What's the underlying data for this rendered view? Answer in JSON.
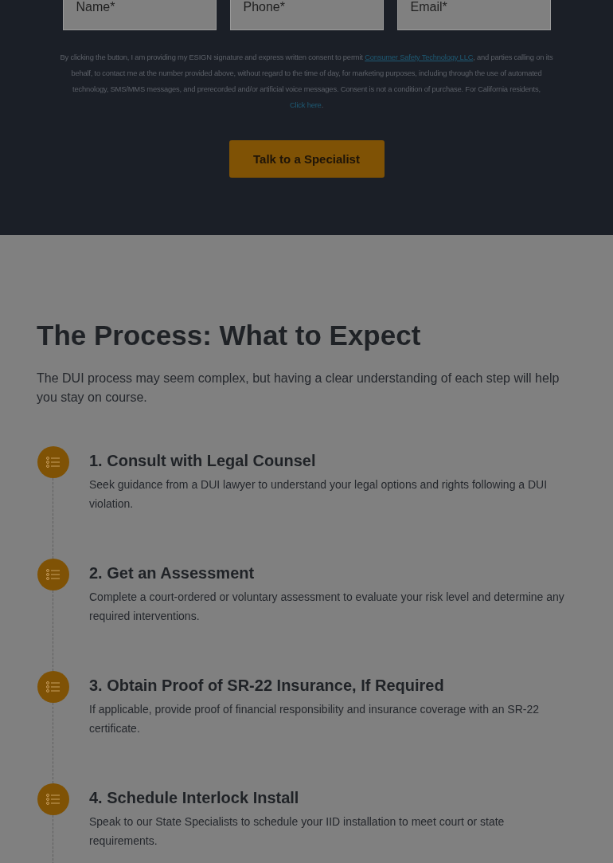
{
  "form": {
    "fields": [
      {
        "placeholder": "Name*"
      },
      {
        "placeholder": "Phone*"
      },
      {
        "placeholder": "Email*"
      }
    ],
    "consent": {
      "before": "By clicking the button, I am providing my ESIGN signature and express written consent to permit ",
      "link": "Consumer Safety Technology LLC",
      "middle": ", and parties calling on its behalf, to contact me at the number provided above, without regard to the time of day, for marketing purposes, including through the use of automated technology, SMS/MMS messages, and prerecorded and/or artificial voice messages. Consent is not a condition of purchase. For California residents, ",
      "link2": "Click here",
      "after": "."
    },
    "button": "Talk to a Specialist"
  },
  "process": {
    "title": "The Process: What to Expect",
    "intro": "The DUI process may seem complex, but having a clear understanding of each step will help you stay on course.",
    "steps": [
      {
        "title": "1. Consult with Legal Counsel",
        "text": "Seek guidance from a DUI lawyer to understand your legal options and rights following a DUI violation."
      },
      {
        "title": "2. Get an Assessment",
        "text": "Complete a court-ordered or voluntary assessment to evaluate your risk level and determine any required interventions."
      },
      {
        "title": "3. Obtain Proof of SR-22 Insurance, If Required",
        "text": "If applicable, provide proof of financial responsibility and insurance coverage with an SR-22 certificate."
      },
      {
        "title": "4. Schedule Interlock Install",
        "text": "Speak to our State Specialists to schedule your IID installation to meet court or state requirements."
      }
    ]
  }
}
